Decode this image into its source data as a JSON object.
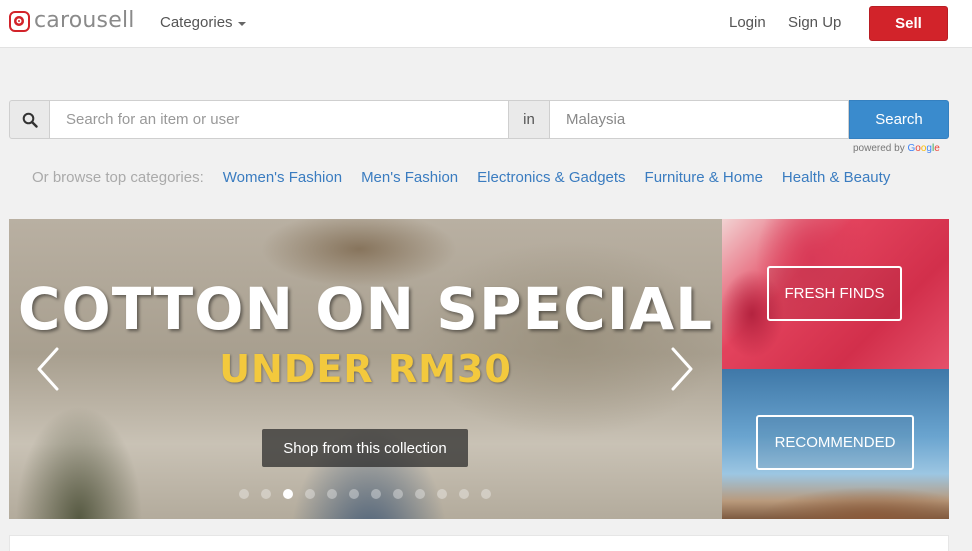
{
  "header": {
    "logo_text": "carousell",
    "categories_label": "Categories",
    "login_label": "Login",
    "signup_label": "Sign Up",
    "sell_label": "Sell"
  },
  "search": {
    "placeholder": "Search for an item or user",
    "in_label": "in",
    "location_placeholder": "Malaysia",
    "button_label": "Search",
    "powered_by": "powered by",
    "google": [
      "G",
      "o",
      "o",
      "g",
      "l",
      "e"
    ]
  },
  "browse": {
    "label": "Or browse top categories:",
    "links": [
      "Women's Fashion",
      "Men's Fashion",
      "Electronics & Gadgets",
      "Furniture & Home",
      "Health & Beauty"
    ]
  },
  "hero": {
    "title": "COTTON ON SPECIAL",
    "subtitle": "UNDER RM30",
    "cta_label": "Shop from this collection",
    "slide_count": 12,
    "active_slide": 3
  },
  "tiles": {
    "fresh_finds": "FRESH FINDS",
    "recommended": "RECOMMENDED"
  },
  "colors": {
    "brand_red": "#d2232a",
    "search_blue": "#3a8bcd",
    "link_blue": "#3a7cc0",
    "subtitle_yellow": "#f3c93d"
  },
  "icons": [
    "logo-icon",
    "search-icon",
    "chevron-down-icon",
    "chevron-left-icon",
    "chevron-right-icon"
  ]
}
